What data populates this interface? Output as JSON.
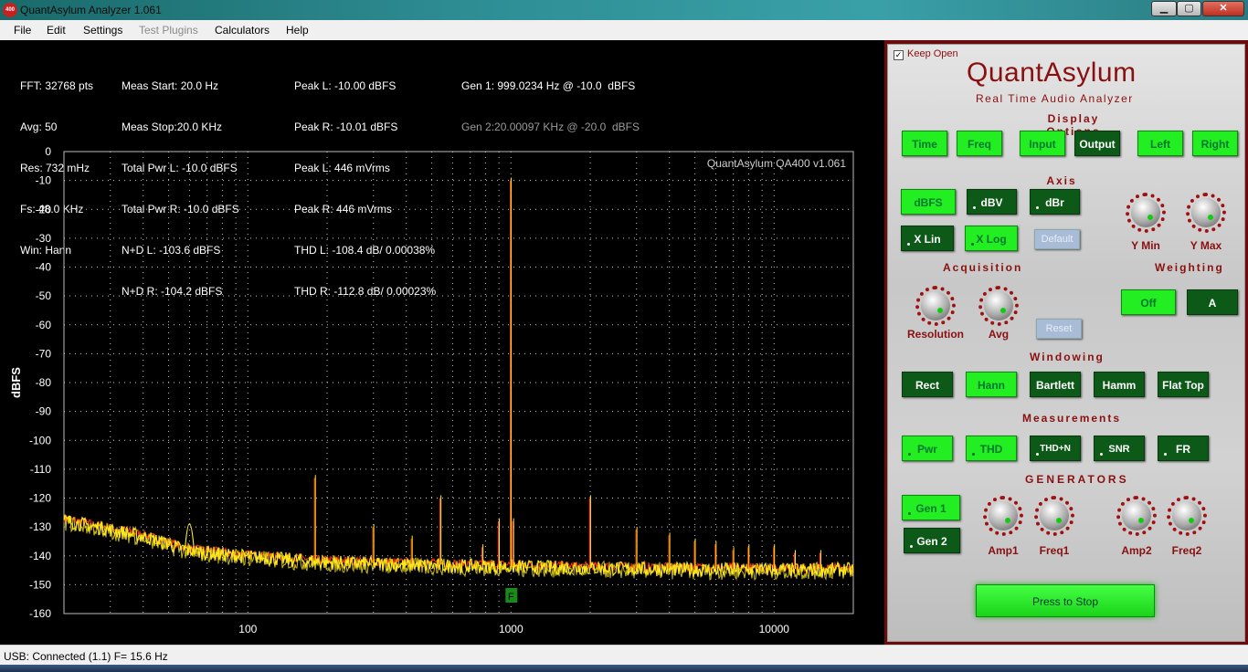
{
  "window": {
    "app_icon_text": "400",
    "title": "QuantAsylum Analyzer 1.061",
    "min_glyph": "▁",
    "max_glyph": "▢",
    "close_glyph": "✕"
  },
  "menu": [
    "File",
    "Edit",
    "Settings",
    "Test Plugins",
    "Calculators",
    "Help"
  ],
  "info": {
    "col1": [
      "FFT: 32768 pts",
      "Avg: 50",
      "Res: 732 mHz",
      "Fs: 48.0 KHz",
      "Win: Hann"
    ],
    "col2": [
      "Meas Start: 20.0 Hz",
      "Meas Stop:20.0 KHz",
      "Total Pwr L: -10.0 dBFS",
      "Total Pwr R: -10.0 dBFS",
      "N+D L: -103.6 dBFS",
      "N+D R: -104.2 dBFS"
    ],
    "col3": [
      "Peak L: -10.00 dBFS",
      "Peak R: -10.01 dBFS",
      "Peak L: 446 mVrms",
      "Peak R: 446 mVrms",
      "THD L: -108.4 dB/ 0.00038%",
      "THD R: -112.8 dB/ 0.00023%"
    ],
    "gen1": "Gen 1: 999.0234 Hz @ -10.0  dBFS",
    "gen2": "Gen 2:20.00097 KHz @ -20.0  dBFS"
  },
  "chart_data": {
    "type": "line",
    "watermark": "QuantAsylum QA400 v1.061",
    "ylabel": "dBFS",
    "xlabel": "",
    "x_scale": "log",
    "xlim": [
      20,
      20000
    ],
    "ylim": [
      -160,
      0
    ],
    "y_ticks": [
      0,
      -10,
      -20,
      -30,
      -40,
      -50,
      -60,
      -70,
      -80,
      -90,
      -100,
      -110,
      -120,
      -130,
      -140,
      -150,
      -160
    ],
    "x_ticks": [
      100,
      1000,
      10000
    ],
    "grid": true,
    "marker_label": "F",
    "marker_x": 1000,
    "noise_floor": [
      [
        20,
        -127.5
      ],
      [
        40,
        -133
      ],
      [
        60,
        -138
      ],
      [
        100,
        -140
      ],
      [
        200,
        -142
      ],
      [
        500,
        -143
      ],
      [
        1000,
        -143.5
      ],
      [
        2000,
        -144
      ],
      [
        5000,
        -144.5
      ],
      [
        20000,
        -144.5
      ]
    ],
    "peaks": [
      {
        "x": 60,
        "y": -121
      },
      {
        "x": 180,
        "y": -113
      },
      {
        "x": 300,
        "y": -130
      },
      {
        "x": 420,
        "y": -134
      },
      {
        "x": 540,
        "y": -120
      },
      {
        "x": 780,
        "y": -137
      },
      {
        "x": 900,
        "y": -128
      },
      {
        "x": 999,
        "y": -10
      },
      {
        "x": 1020,
        "y": -128
      },
      {
        "x": 2000,
        "y": -120
      },
      {
        "x": 3000,
        "y": -131
      },
      {
        "x": 4000,
        "y": -133
      },
      {
        "x": 5000,
        "y": -135
      },
      {
        "x": 6000,
        "y": -136
      },
      {
        "x": 7000,
        "y": -138
      },
      {
        "x": 8000,
        "y": -137
      },
      {
        "x": 10000,
        "y": -137
      },
      {
        "x": 12000,
        "y": -139
      },
      {
        "x": 15000,
        "y": -139
      }
    ],
    "colors": {
      "left": "#ff3a10",
      "right": "#ffe820",
      "grid": "#c8c8c8"
    }
  },
  "panel": {
    "keep_open": "Keep Open",
    "brand": "QuantAsylum",
    "subbrand": "Real Time Audio Analyzer",
    "sections": {
      "display": "Display Options",
      "axis": "Axis",
      "acquisition": "Acquisition",
      "weighting": "Weighting",
      "windowing": "Windowing",
      "measurements": "Measurements",
      "generators": "GENERATORS"
    },
    "display_buttons": [
      "Time",
      "Freq",
      "Input",
      "Output",
      "Left",
      "Right"
    ],
    "axis_buttons": [
      "dBFS",
      "dBV",
      "dBr"
    ],
    "scale_buttons": [
      "X Lin",
      "X Log",
      "Default"
    ],
    "weighting_buttons": [
      "Off",
      "A"
    ],
    "reset": "Reset",
    "window_buttons": [
      "Rect",
      "Hann",
      "Bartlett",
      "Hamm",
      "Flat Top"
    ],
    "meas_buttons": [
      "Pwr",
      "THD",
      "THD+N",
      "SNR",
      "FR"
    ],
    "gen_buttons": [
      "Gen 1",
      "Gen 2"
    ],
    "knobs": {
      "ymin": "Y Min",
      "ymax": "Y Max",
      "resolution": "Resolution",
      "avg": "Avg",
      "amp1": "Amp1",
      "freq1": "Freq1",
      "amp2": "Amp2",
      "freq2": "Freq2"
    },
    "press_stop": "Press to Stop"
  },
  "status": "USB: Connected  (1.1)  F= 15.6 Hz"
}
